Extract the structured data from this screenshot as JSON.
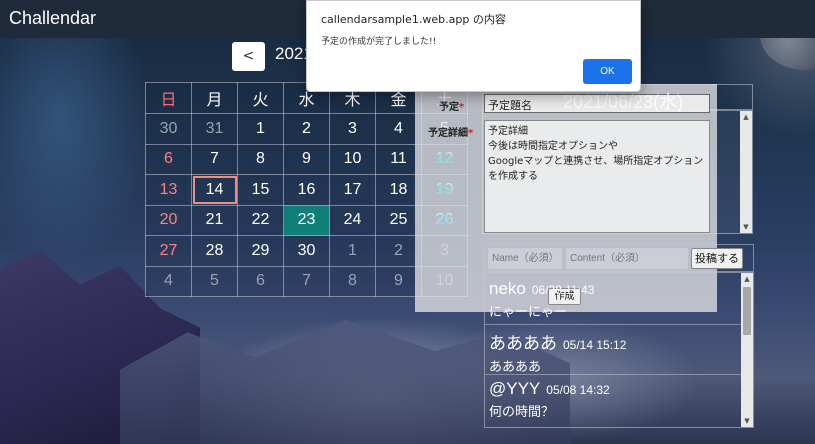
{
  "app": {
    "title": "Challendar"
  },
  "nav": {
    "prev_label": "<",
    "month_label": "2021"
  },
  "calendar": {
    "weekdays": [
      "日",
      "月",
      "火",
      "水",
      "木",
      "金",
      "土"
    ],
    "weeks": [
      [
        "30",
        "31",
        "1",
        "2",
        "3",
        "4",
        "5"
      ],
      [
        "6",
        "7",
        "8",
        "9",
        "10",
        "11",
        "12"
      ],
      [
        "13",
        "14",
        "15",
        "16",
        "17",
        "18",
        "19"
      ],
      [
        "20",
        "21",
        "22",
        "23",
        "24",
        "25",
        "26"
      ],
      [
        "27",
        "28",
        "29",
        "30",
        "1",
        "2",
        "3"
      ],
      [
        "4",
        "5",
        "6",
        "7",
        "8",
        "9",
        "10"
      ]
    ],
    "today": "14",
    "selected": "23",
    "colors": {
      "sunday": "#ff8080",
      "selected_bg": "#0f7f78",
      "today_border": "#e8917f"
    }
  },
  "selected_date": "2021/06/23(水)",
  "schedule_form": {
    "title_label": "予定",
    "detail_label": "予定詳細",
    "required_mark": "*",
    "title_value": "予定題名",
    "detail_value": "予定詳細\n今後は時間指定オプションや\nGoogleマップと連携させ、場所指定オプションを作成する",
    "submit_label": "作成"
  },
  "comment_form": {
    "name_placeholder": "Name（必須）",
    "content_placeholder": "Content（必須）",
    "post_label": "投稿する"
  },
  "comments": [
    {
      "name": "neko",
      "time": "06/28 11:43",
      "body": "にゃーにゃー"
    },
    {
      "name": "ああああ",
      "time": "05/14 15:12",
      "body": "ああああ"
    },
    {
      "name": "@YYY",
      "time": "05/08 14:32",
      "body": "何の時間？"
    }
  ],
  "dialog": {
    "title": "callendarsample1.web.app の内容",
    "message": "予定の作成が完了しました!!",
    "ok_label": "OK",
    "ok_color": "#1a73e8"
  }
}
